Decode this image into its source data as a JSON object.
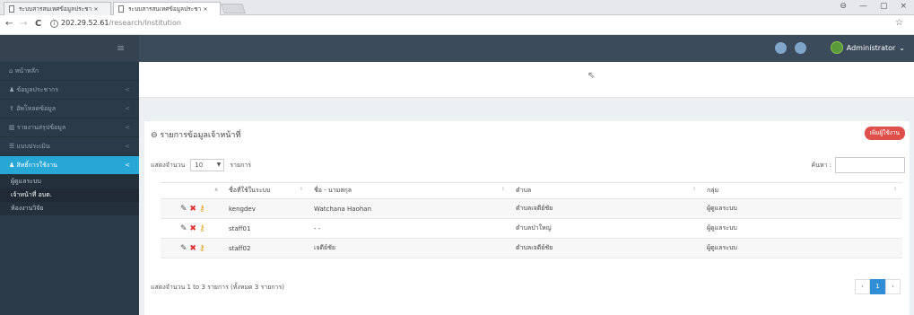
{
  "browser": {
    "tab1_title": "ระบบสารสนเทศข้อมูลประชา ×",
    "tab2_title": "ระบบสารสนเทศข้อมูลประชา ×",
    "url_host": "202.29.52.61",
    "url_path": "/research/Institution",
    "win_min": "—",
    "win_max": "▢",
    "win_close": "×",
    "profile_icon": "⊖",
    "back": "←",
    "forward": "→",
    "reload": "C",
    "star": "☆"
  },
  "topbar": {
    "user_name": "Administrator",
    "user_caret": "⌄"
  },
  "sidebar": {
    "items": [
      {
        "label": "หน้าหลัก",
        "chev": ""
      },
      {
        "label": "ข้อมูลประชากร",
        "chev": "<"
      },
      {
        "label": "อัพโหลดข้อมูล",
        "chev": "<"
      },
      {
        "label": "รายงานสรุปข้อมูล",
        "chev": "<"
      },
      {
        "label": "แบบประเมิน",
        "chev": "<"
      },
      {
        "label": "สิทธิ์การใช้งาน",
        "chev": "<"
      }
    ],
    "sub_items": [
      "ผู้ดูแลระบบ",
      "เจ้าหน้าที่ อบต.",
      "ห้องงานวิจัย"
    ]
  },
  "panel": {
    "title": "รายการข้อมูลเจ้าหน้าที่",
    "add_button": "เพิ่มผู้ใช้งาน",
    "length_label": "แสดงจำนวน",
    "length_value": "10",
    "length_suffix": "รายการ",
    "search_label": "ค้นหา :",
    "columns": [
      "",
      "ชื่อที่ใช้ในระบบ",
      "ชื่อ - นามสกุล",
      "ตำบล",
      "กลุ่ม"
    ],
    "rows": [
      {
        "username": "kengdev",
        "fullname": "Watchana Haohan",
        "subdistrict": "ตำบลเจดีย์ชัย",
        "group": "ผู้ดูแลระบบ"
      },
      {
        "username": "staff01",
        "fullname": "- -",
        "subdistrict": "ตำบลป่าใหญ่",
        "group": "ผู้ดูแลระบบ"
      },
      {
        "username": "staff02",
        "fullname": "เจดีย์ชัย",
        "subdistrict": "ตำบลเจดีย์ชัย",
        "group": "ผู้ดูแลระบบ"
      }
    ],
    "info": "แสดงจำนวน 1 to 3 รายการ (ทั้งหมด 3 รายการ)",
    "pager": {
      "prev": "‹",
      "current": "1",
      "next": "›"
    }
  }
}
